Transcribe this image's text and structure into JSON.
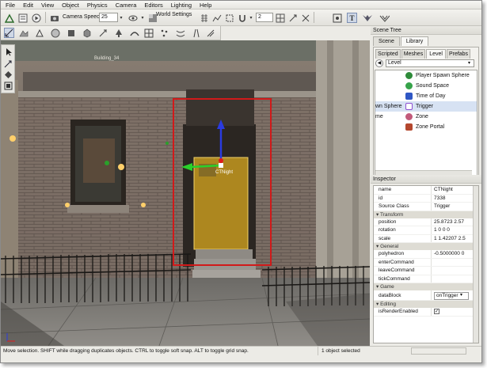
{
  "menu": [
    "File",
    "Edit",
    "View",
    "Object",
    "Physics",
    "Camera",
    "Editors",
    "Lighting",
    "Help"
  ],
  "toolbar": {
    "camera_speed_label": "Camera Speed",
    "camera_speed_value": "25",
    "grid_value": "2",
    "world_settings_label": "World Settings"
  },
  "viewport": {
    "building_label": "Building_34",
    "object_label": "CTNight",
    "selection_color": "#d11a1a",
    "trigger_color": "#d9a81f"
  },
  "status": {
    "hint": "Move selection.  SHIFT while dragging duplicates objects.  CTRL to toggle soft snap.  ALT to toggle grid snap.",
    "selected": "1 object selected"
  },
  "scene_tree": {
    "title": "Scene Tree",
    "tabs": [
      "Scene",
      "Library"
    ],
    "subtabs": [
      "Scripted",
      "Meshes",
      "Level",
      "Prefabs"
    ],
    "dropdown": "Level",
    "items": [
      {
        "label": "Player Spawn Sphere",
        "icon": "green-sphere-icon",
        "color": "#2e8b3a",
        "cut": ""
      },
      {
        "label": "Sound Space",
        "icon": "sound-icon",
        "color": "#36a34a",
        "cut": ""
      },
      {
        "label": "Time of Day",
        "icon": "clock-icon",
        "color": "#2f57c4",
        "cut": ""
      },
      {
        "label": "Trigger",
        "icon": "trigger-icon",
        "color": "#8c4fd1",
        "cut": "wn Sphere"
      },
      {
        "label": "Zone",
        "icon": "zone-icon",
        "color": "#c25a7a",
        "cut": "me"
      },
      {
        "label": "Zone Portal",
        "icon": "portal-icon",
        "color": "#b4472e",
        "cut": ""
      }
    ]
  },
  "inspector": {
    "title": "Inspector",
    "header": [
      {
        "key": "name",
        "value": "CTNight"
      },
      {
        "key": "id",
        "value": "7338"
      },
      {
        "key": "Source Class",
        "value": "Trigger"
      }
    ],
    "transform_title": "Transform",
    "transform": [
      {
        "key": "position",
        "value": "25.8723 2.57"
      },
      {
        "key": "rotation",
        "value": "1 0 0 0"
      },
      {
        "key": "scale",
        "value": "1 1.42207 2.5"
      }
    ],
    "general_title": "General",
    "general": [
      {
        "key": "polyhedron",
        "value": "-0.5000000 0"
      },
      {
        "key": "enterCommand",
        "value": ""
      },
      {
        "key": "leaveCommand",
        "value": ""
      },
      {
        "key": "tickCommand",
        "value": ""
      }
    ],
    "game_title": "Game",
    "datablock_key": "dataBlock",
    "datablock_value": "onTrigger",
    "editing_title": "Editing",
    "editing_key": "isRenderEnabled"
  }
}
